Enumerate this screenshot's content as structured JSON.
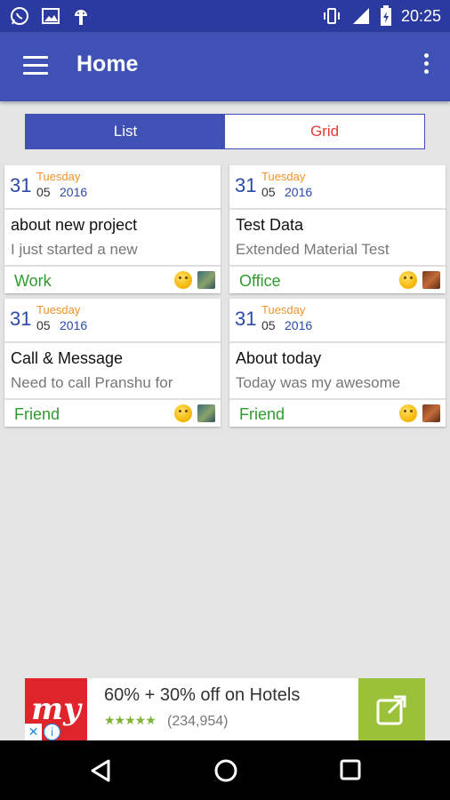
{
  "status_bar": {
    "time": "20:25",
    "left_icons": [
      "whatsapp-icon",
      "image-icon",
      "android-icon"
    ],
    "right_icons": [
      "vibrate-icon",
      "signal-icon",
      "battery-icon"
    ]
  },
  "app_bar": {
    "title": "Home",
    "menu_icon": "hamburger-menu-icon",
    "overflow_icon": "more-vertical-icon"
  },
  "tabs": [
    {
      "label": "List",
      "selected": true
    },
    {
      "label": "Grid",
      "selected": false
    }
  ],
  "notes": [
    {
      "day": "31",
      "weekday": "Tuesday",
      "month": "05",
      "year": "2016",
      "title": "about new project",
      "preview": "I just started a new",
      "category": "Work",
      "mood_icon": "smile-emoji-icon",
      "attachment_icon": "photo-thumbnail-icon"
    },
    {
      "day": "31",
      "weekday": "Tuesday",
      "month": "05",
      "year": "2016",
      "title": "Test Data",
      "preview": "Extended Material Test",
      "category": "Office",
      "mood_icon": "sad-emoji-icon",
      "attachment_icon": "photo-thumbnail-icon"
    },
    {
      "day": "31",
      "weekday": "Tuesday",
      "month": "05",
      "year": "2016",
      "title": "Call & Message",
      "preview": "Need to call Pranshu for",
      "category": "Friend",
      "mood_icon": "sad-emoji-icon",
      "attachment_icon": "photo-thumbnail-icon"
    },
    {
      "day": "31",
      "weekday": "Tuesday",
      "month": "05",
      "year": "2016",
      "title": "About today",
      "preview": "Today was my awesome",
      "category": "Friend",
      "mood_icon": "happy-emoji-icon",
      "attachment_icon": "photo-thumbnail-icon"
    }
  ],
  "ad": {
    "logo_text": "my",
    "headline": "60% + 30% off on Hotels",
    "stars": "★★★★★",
    "rating_count": "(234,954)",
    "close_symbol": "✕",
    "info_symbol": "i"
  },
  "colors": {
    "primary": "#3f51b5",
    "status_bar": "#2b3a9e",
    "accent_red": "#e53935",
    "category_green": "#2e9b2e",
    "weekday_orange": "#f0932b",
    "ad_green": "#9bc13a",
    "ad_red": "#e0242b"
  }
}
